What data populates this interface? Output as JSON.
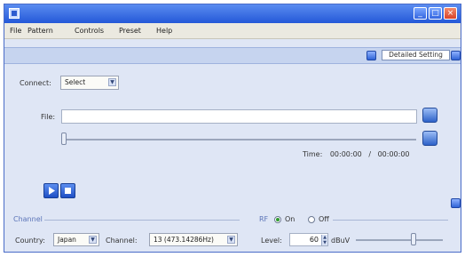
{
  "menu": {
    "items": [
      "File",
      "Pattern",
      "Controls",
      "Preset",
      "Help"
    ]
  },
  "detail": {
    "button_label": "Detailed Setting"
  },
  "connect": {
    "label": "Connect:",
    "value": "Select"
  },
  "file": {
    "label": "File:",
    "value": ""
  },
  "time": {
    "label": "Time:",
    "current": "00:00:00",
    "separator": "/",
    "total": "00:00:00"
  },
  "channel_group": {
    "title": "Channel",
    "country_label": "Country:",
    "country_value": "Japan",
    "channel_label": "Channel:",
    "channel_value": "13 (473.14286Hz)"
  },
  "rf_group": {
    "title": "RF",
    "on_label": "On",
    "off_label": "Off",
    "selected": "On",
    "level_label": "Level:",
    "level_value": "60",
    "level_unit": "dBuV"
  },
  "icons": {
    "app": "app-icon",
    "minimize": "minimize-icon",
    "maximize": "maximize-icon",
    "close": "close-icon",
    "browse": "folder-icon",
    "load": "load-icon",
    "play": "play-icon",
    "stop": "stop-icon",
    "help": "info-icon"
  }
}
